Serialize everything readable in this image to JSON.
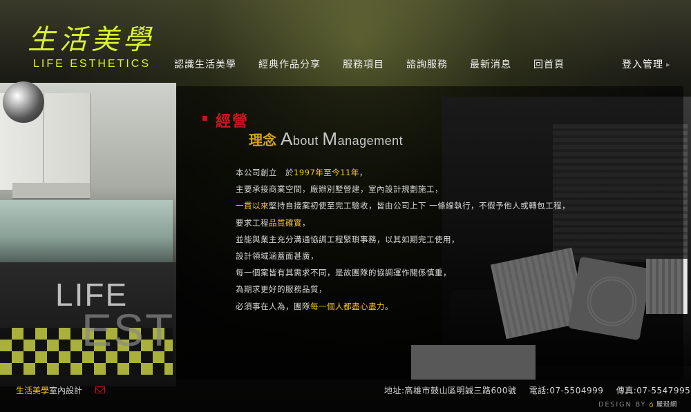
{
  "header": {
    "logo_cn": "生活美學",
    "logo_en": "LIFE ESTHETICS",
    "nav": [
      {
        "label": "認識生活美學"
      },
      {
        "label": "經典作品分享"
      },
      {
        "label": "服務項目"
      },
      {
        "label": "諮詢服務"
      },
      {
        "label": "最新消息"
      },
      {
        "label": "回首頁"
      }
    ],
    "login": "登入管理"
  },
  "background": {
    "word1": "LIFE",
    "word2": "EST"
  },
  "content": {
    "title_top": "經營",
    "title_cn": "理念",
    "title_en_A": "A",
    "title_en_rest1": "bout ",
    "title_en_M": "M",
    "title_en_rest2": "anagement",
    "lines": {
      "l1a": "本公司創立　於",
      "l1b": "1997年至今11年",
      "l1c": "，",
      "l2": "主要承接商業空間，廠辦別墅營建，室內設計規劃施工，",
      "l3a": "一貫以來",
      "l3b": "堅持自接案初使至完工驗收，皆由公司上下 一條線執行，不假予他人或轉包工程，",
      "l4a": "要求工程",
      "l4b": "品質確實",
      "l4c": "，",
      "l5": "並能與業主充分溝通協調工程緊瑣事務，以其如期完工使用，",
      "l6": "設計領域涵蓋面甚廣，",
      "l7": "每一個案皆有其需求不同，是故團隊的協調運作關係慎重，",
      "l8": "為期求更好的服務品質，",
      "l9a": "必須事在人為，團隊",
      "l9b": "每一個人都盡心盡力",
      "l9c": "。"
    }
  },
  "footer": {
    "name_hl": "生活美學",
    "name_rest": "室內設計",
    "address": "地址:高雄市鼓山區明誠三路600號",
    "phone": "電話:07-5504999",
    "fax": "傳真:07-5547995",
    "design_by": "DESIGN BY",
    "design_brand": "屋殼網"
  },
  "colors": {
    "accent": "#d9f22f",
    "highlight": "#f5c81a",
    "title_red": "#c8171d",
    "title_gold": "#d8a21a"
  }
}
